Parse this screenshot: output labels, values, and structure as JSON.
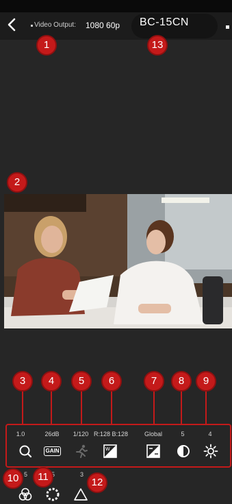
{
  "header": {
    "back_icon": "chevron-left-icon",
    "video_output_label": "Video Output:",
    "video_output_value": "1080 60p",
    "device_name": "BC-15CN",
    "menu_icon": "square-dot-icon"
  },
  "toolbar": [
    {
      "id": "zoom",
      "value": "1.0",
      "icon": "zoom-icon"
    },
    {
      "id": "gain",
      "value": "26dB",
      "icon": "gain-icon",
      "icon_text": "GAIN"
    },
    {
      "id": "shutter",
      "value": "1/120",
      "icon": "shutter-runner-icon"
    },
    {
      "id": "white_balance",
      "value": "R:128 B:128",
      "icon": "white-balance-icon"
    },
    {
      "id": "exposure",
      "value": "Global",
      "icon": "exposure-icon"
    },
    {
      "id": "contrast",
      "value": "5",
      "icon": "contrast-icon"
    },
    {
      "id": "brightness",
      "value": "4",
      "icon": "brightness-icon"
    }
  ],
  "bottom_tools": [
    {
      "id": "saturation",
      "value": "5",
      "icon": "color-circles-icon"
    },
    {
      "id": "hue",
      "value": "5",
      "icon": "dotted-circle-icon"
    },
    {
      "id": "sharpness",
      "value": "3",
      "icon": "triangle-icon"
    }
  ],
  "callouts": [
    "1",
    "2",
    "3",
    "4",
    "5",
    "6",
    "7",
    "8",
    "9",
    "10",
    "11",
    "12",
    "13"
  ],
  "colors": {
    "accent_red": "#c41a1a",
    "background": "#262626"
  }
}
